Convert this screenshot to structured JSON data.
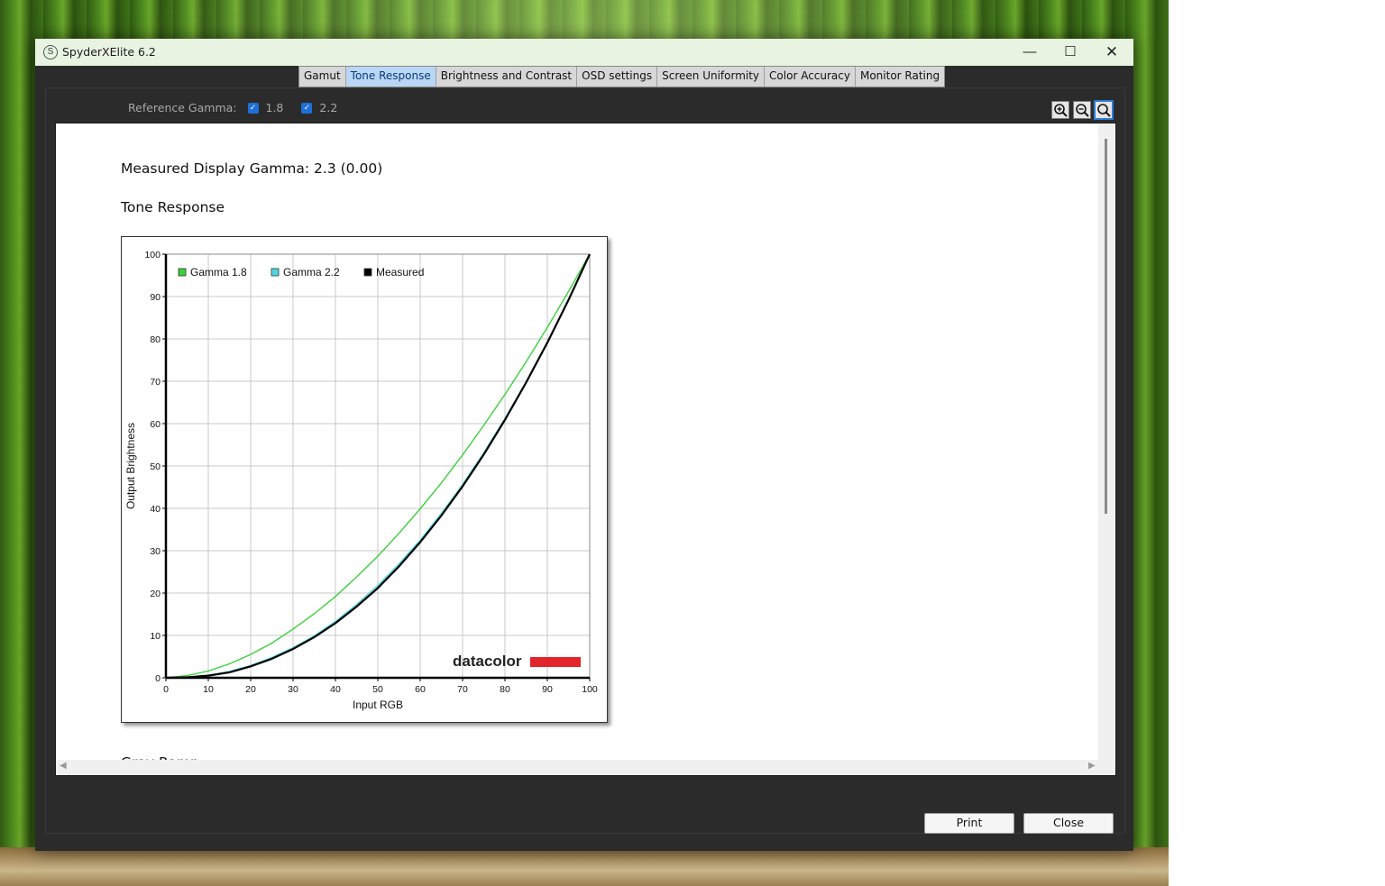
{
  "window": {
    "title": "SpyderXElite 6.2",
    "app_icon": "S",
    "controls": {
      "minimize": "—",
      "maximize": "☐",
      "close": "✕"
    }
  },
  "tabs": [
    {
      "label": "Gamut",
      "active": false
    },
    {
      "label": "Tone Response",
      "active": true
    },
    {
      "label": "Brightness and Contrast",
      "active": false
    },
    {
      "label": "OSD settings",
      "active": false
    },
    {
      "label": "Screen Uniformity",
      "active": false
    },
    {
      "label": "Color Accuracy",
      "active": false
    },
    {
      "label": "Monitor Rating",
      "active": false
    }
  ],
  "reference_gamma": {
    "label": "Reference Gamma:",
    "options": [
      {
        "label": "1.8",
        "checked": true
      },
      {
        "label": "2.2",
        "checked": true
      }
    ]
  },
  "zoom_toolbar": {
    "zoom_in_icon": "zoom-in-icon",
    "zoom_out_icon": "zoom-out-icon",
    "zoom_fit_icon": "zoom-fit-icon"
  },
  "report": {
    "measured_gamma": "Measured Display Gamma: 2.3 (0.00)",
    "section_title": "Tone Response",
    "next_section_title": "Gray Ramp"
  },
  "buttons": {
    "print": "Print",
    "close": "Close"
  },
  "chart_data": {
    "type": "line",
    "title": "",
    "xlabel": "Input RGB",
    "ylabel": "Output Brightness",
    "xlim": [
      0,
      100
    ],
    "ylim": [
      0,
      100
    ],
    "xticks": [
      0,
      10,
      20,
      30,
      40,
      50,
      60,
      70,
      80,
      90,
      100
    ],
    "yticks": [
      0,
      10,
      20,
      30,
      40,
      50,
      60,
      70,
      80,
      90,
      100
    ],
    "grid": true,
    "legend_position": "top-left",
    "watermark": "datacolor",
    "x": [
      0,
      5,
      10,
      15,
      20,
      25,
      30,
      35,
      40,
      45,
      50,
      55,
      60,
      65,
      70,
      75,
      80,
      85,
      90,
      95,
      100
    ],
    "series": [
      {
        "name": "Gamma 1.8",
        "color": "#3cd13c",
        "values": [
          0,
          0.5,
          1.6,
          3.3,
          5.5,
          8.2,
          11.5,
          15.1,
          19.2,
          23.8,
          28.7,
          34.1,
          39.9,
          46.0,
          52.6,
          59.6,
          66.9,
          74.6,
          82.7,
          91.2,
          100
        ]
      },
      {
        "name": "Gamma 2.2",
        "color": "#4fd6e0",
        "values": [
          0,
          0.1,
          0.6,
          1.5,
          2.9,
          4.8,
          7.1,
          9.9,
          13.3,
          17.3,
          21.8,
          26.9,
          32.5,
          38.8,
          45.6,
          53.1,
          61.2,
          69.9,
          79.3,
          89.3,
          100
        ]
      },
      {
        "name": "Measured",
        "color": "#000000",
        "values": [
          0,
          0.1,
          0.5,
          1.3,
          2.7,
          4.5,
          6.8,
          9.6,
          12.9,
          16.8,
          21.2,
          26.3,
          32.0,
          38.3,
          45.2,
          52.7,
          60.9,
          69.7,
          79.1,
          89.2,
          100
        ]
      }
    ]
  }
}
